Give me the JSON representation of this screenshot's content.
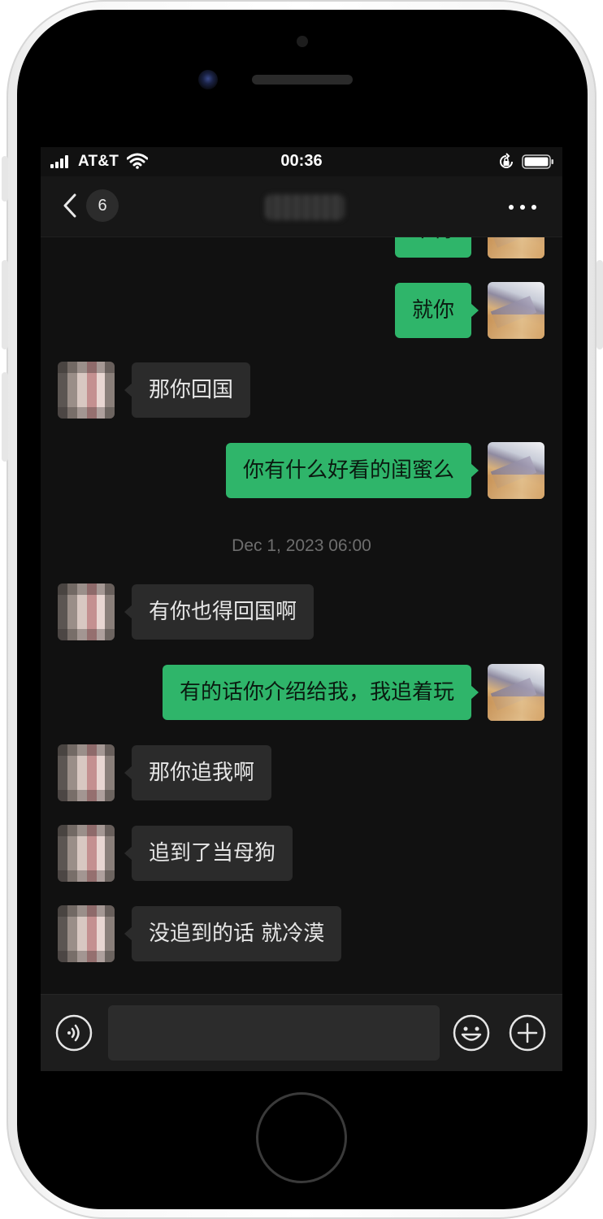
{
  "status_bar": {
    "carrier": "AT&T",
    "time": "00:36",
    "icons": [
      "signal-icon",
      "wifi-icon",
      "rotation-lock-icon",
      "battery-icon"
    ]
  },
  "nav": {
    "back_icon": "chevron-left-icon",
    "unread_count": "6",
    "title": "",
    "more_icon": "more-icon"
  },
  "messages": [
    {
      "side": "out",
      "text": "干得"
    },
    {
      "side": "out",
      "text": "就你"
    },
    {
      "side": "in",
      "text": "那你回国"
    },
    {
      "side": "out",
      "text": "你有什么好看的闺蜜么"
    },
    {
      "type": "timestamp",
      "text": "Dec 1, 2023 06:00"
    },
    {
      "side": "in",
      "text": "有你也得回国啊"
    },
    {
      "side": "out",
      "text": "有的话你介绍给我，我追着玩"
    },
    {
      "side": "in",
      "text": "那你追我啊"
    },
    {
      "side": "in",
      "text": "追到了当母狗"
    },
    {
      "side": "in",
      "text": "没追到的话 就冷漠"
    }
  ],
  "input_bar": {
    "voice_icon": "voice-icon",
    "input_value": "",
    "emoji_icon": "emoji-icon",
    "plus_icon": "plus-icon"
  },
  "colors": {
    "screen_bg": "#111111",
    "outgoing_bubble": "#2fb56a",
    "incoming_bubble": "#2b2b2b",
    "timestamp_text": "#6e6e6e"
  }
}
